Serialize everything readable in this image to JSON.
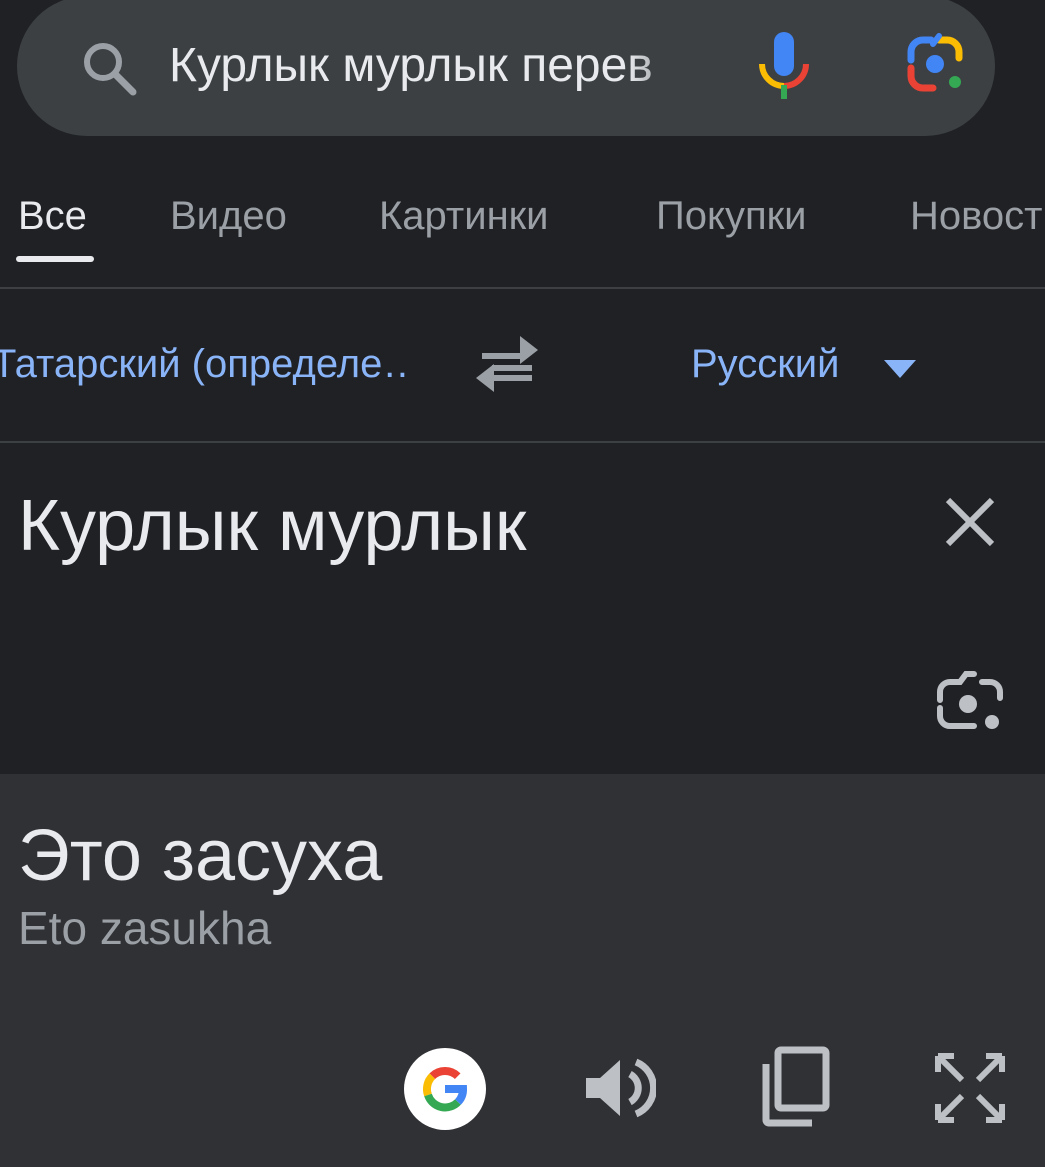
{
  "search": {
    "query": "Курлык мурлык перев"
  },
  "tabs": [
    {
      "label": "Все",
      "active": true
    },
    {
      "label": "Видео",
      "active": false
    },
    {
      "label": "Картинки",
      "active": false
    },
    {
      "label": "Покупки",
      "active": false
    },
    {
      "label": "Новост",
      "active": false
    }
  ],
  "translator": {
    "source_language": "Татарский (определе…",
    "target_language": "Русский",
    "source_text": "Курлык мурлык",
    "translation": "Это засуха",
    "transliteration": "Eto zasukha"
  },
  "icons": {
    "search": "search-icon",
    "voice": "mic-icon",
    "lens": "google-lens-icon",
    "swap": "swap-languages-icon",
    "dropdown": "dropdown-arrow-icon",
    "clear": "close-icon",
    "camera": "camera-translate-icon",
    "google": "google-logo-icon",
    "listen": "speaker-icon",
    "copy": "copy-icon",
    "expand": "fullscreen-icon"
  },
  "colors": {
    "background": "#202124",
    "surface": "#303134",
    "search_bar": "#3c4043",
    "text_primary": "#e8eaed",
    "text_secondary": "#9aa0a6",
    "accent_blue": "#8ab4f8",
    "google_blue": "#4285f4",
    "google_red": "#ea4335",
    "google_yellow": "#fbbc04",
    "google_green": "#34a853"
  }
}
